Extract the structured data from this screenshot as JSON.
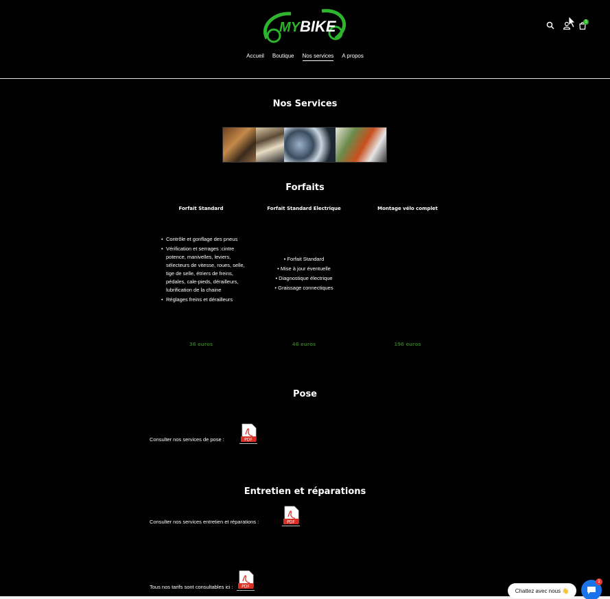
{
  "brand": {
    "logo_text": "MYBIKE"
  },
  "nav": [
    "Accueil",
    "Boutique",
    "Nos services",
    "A propos"
  ],
  "nav_active": 2,
  "header_icons": [
    "search-icon",
    "user-icon",
    "cart-icon"
  ],
  "cart_count": "1",
  "page_title": "Nos Services",
  "forfaits": {
    "title": "Forfaits",
    "columns": [
      {
        "name": "Forfait Standard",
        "items": [
          "Contrôle et gonflage des pneus",
          "Vérification et serrages :cintre potence, manivelles, leviers, sélecteurs de vitesse, roues, selle, tige de selle, étriers de freins, pédales, cale-pieds, dérailleurs, lubrification de la chaine",
          "Réglages freins et dérailleurs"
        ],
        "price": "36 euros"
      },
      {
        "name": "Forfait Standard Electrique",
        "items": [
          "Forfait Standard",
          "Mise à jour éventuelle",
          "Diagnostique électrique",
          "Graissage connectiques"
        ],
        "price": "46 euros"
      },
      {
        "name": "Montage vélo complet",
        "items": [],
        "price": "196 euros"
      }
    ]
  },
  "pose": {
    "title": "Pose",
    "text": "Consulter nos services de pose :"
  },
  "entretien": {
    "title": "Entretien et réparations",
    "text": "Consulter nos services entretien et réparations :"
  },
  "tarifs": {
    "text": "Tous nos tarifs sont consultables ici :"
  },
  "pdf_label": "PDF",
  "chat": {
    "label": "Chattez avec nous 👋",
    "badge": "1"
  },
  "colors": {
    "accent_green": "#2db52d",
    "price_green": "#2f6b1e",
    "pdf_red": "#d93025",
    "chat_blue": "#1a73e8"
  }
}
